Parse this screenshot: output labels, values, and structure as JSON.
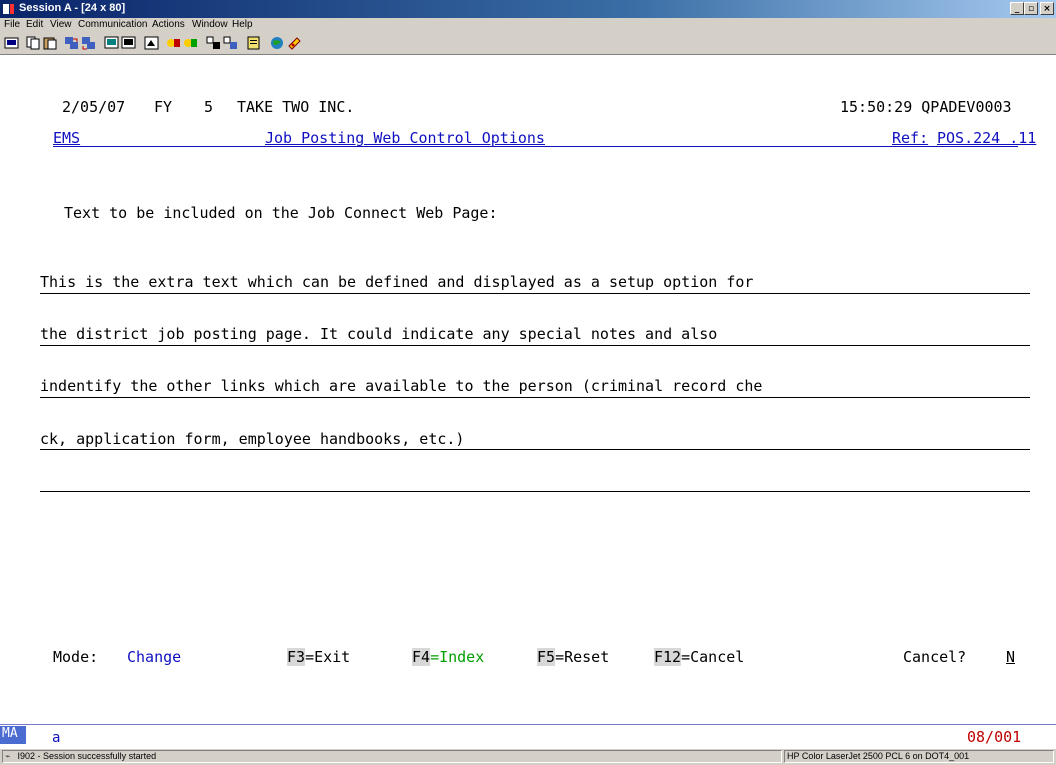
{
  "window": {
    "title": "Session A - [24 x 80]",
    "controls": [
      "_",
      "▫",
      "×"
    ]
  },
  "menu": [
    "File",
    "Edit",
    "View",
    "Communication",
    "Actions",
    "Window",
    "Help"
  ],
  "header": {
    "date": "2/05/07",
    "fy_label": "FY",
    "fy_value": "5",
    "company": "TAKE TWO INC.",
    "time_id": "15:50:29 QPADEV0003",
    "system": "EMS",
    "screen_title": "Job Posting Web Control Options",
    "ref_label": "Ref:",
    "ref_value": "POS.224 .11"
  },
  "prompt": "Text to be included on the Job Connect Web Page:",
  "text_lines": [
    "This is the extra text which can be defined and displayed as a setup option for",
    "the district job posting page. It could indicate any special notes and also",
    "indentify the other links which are available to the person (criminal record che",
    "ck, application form, employee handbooks, etc.)",
    ""
  ],
  "footer": {
    "mode_label": "Mode:",
    "mode_value": "Change",
    "f3_key": "F3",
    "f3_text": "=Exit",
    "f4_key": "F4",
    "f4_text": "=Index",
    "f5_key": "F5",
    "f5_text": "=Reset",
    "f12_key": "F12",
    "f12_text": "=Cancel",
    "cancel_label": "Cancel?",
    "cancel_value": "N"
  },
  "oia": {
    "indicator": "MA",
    "mode": "a",
    "cursor": "08/001"
  },
  "status": {
    "message": "I902 - Session successfully started",
    "printer": "HP Color LaserJet 2500 PCL 6 on DOT4_001"
  }
}
